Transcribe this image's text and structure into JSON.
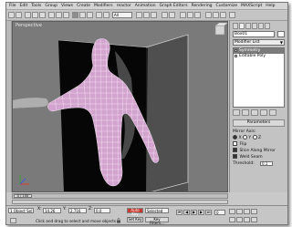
{
  "menu": [
    "File",
    "Edit",
    "Tools",
    "Group",
    "Views",
    "Create",
    "Modifiers",
    "reactor",
    "Animation",
    "Graph Editors",
    "Rendering",
    "Customize",
    "MAXScript",
    "Help"
  ],
  "toolbar": {
    "select_filter": "All"
  },
  "viewport": {
    "label": "Perspective"
  },
  "command_panel": {
    "object_name": "Box01",
    "modifier_list": "Modifier List",
    "stack": [
      "Symmetry",
      "Editable Poly"
    ],
    "rollout_title": "Parameters",
    "params": {
      "mirror_axis_label": "Mirror Axis:",
      "axes": [
        "X",
        "Y",
        "Z"
      ],
      "flip": "Flip",
      "slice": "Slice Along Mirror",
      "weld": "Weld Seam",
      "threshold_label": "Threshold:",
      "threshold_value": "0.1"
    }
  },
  "timeline": {
    "frame": "0 / 100"
  },
  "status": {
    "selected_count": "1 Object Sel",
    "x_label": "X:",
    "x_value": "14.26",
    "y_label": "Y:",
    "y_value": "2.716",
    "z_label": "Z:",
    "z_value": "0.0",
    "auto_key": "Auto Key",
    "selected_dropdown": "Selected",
    "set_key": "Set Key",
    "key_filters": "Key Filters...",
    "current_frame": "0",
    "prompt": "Click and drag to select and move objects"
  },
  "colors": {
    "mesh": "#d3a3cf",
    "backdrop": "#050505",
    "viewport_bg": "#7a7a7a",
    "auto_key_red": "#c9382e"
  }
}
